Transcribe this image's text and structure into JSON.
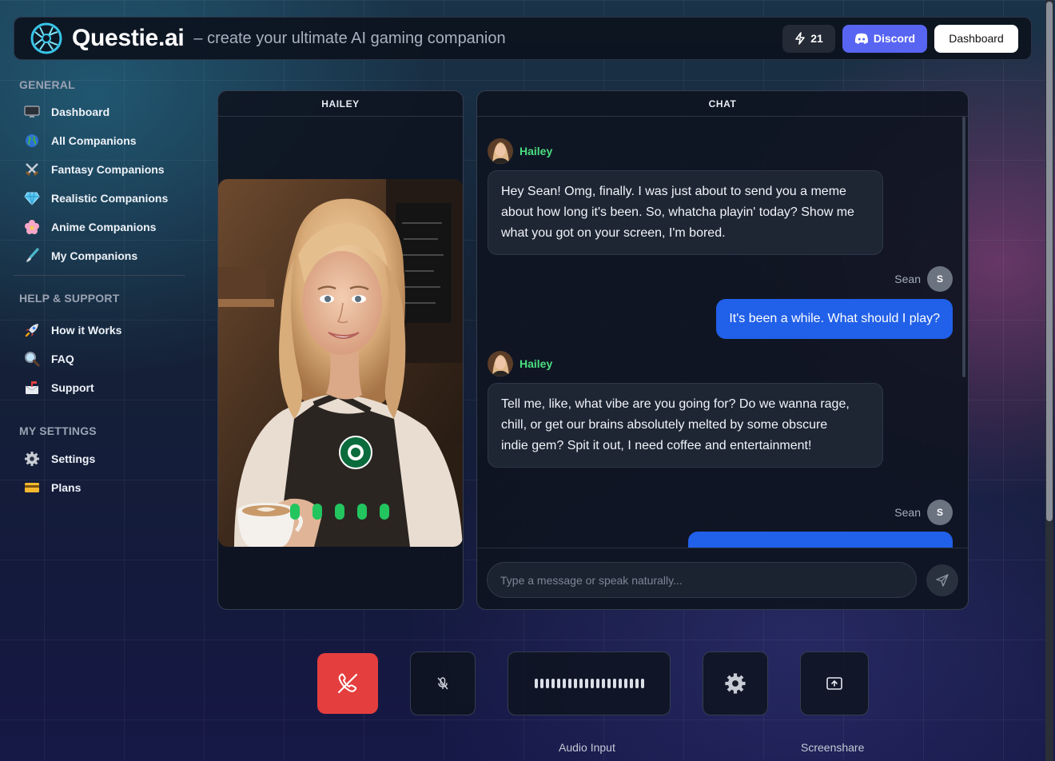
{
  "header": {
    "brand": "Questie.ai",
    "tagline": "– create your ultimate AI gaming companion",
    "credits": "21",
    "discord_label": "Discord",
    "dashboard_label": "Dashboard"
  },
  "sidebar": {
    "sections": [
      {
        "title": "GENERAL",
        "items": [
          {
            "label": "Dashboard",
            "icon": "monitor-icon"
          },
          {
            "label": "All Companions",
            "icon": "globe-icon"
          },
          {
            "label": "Fantasy Companions",
            "icon": "crossed-swords-icon"
          },
          {
            "label": "Realistic Companions",
            "icon": "gem-icon"
          },
          {
            "label": "Anime Companions",
            "icon": "cherry-blossom-icon"
          },
          {
            "label": "My Companions",
            "icon": "paintbrush-icon"
          }
        ]
      },
      {
        "title": "HELP & SUPPORT",
        "items": [
          {
            "label": "How it Works",
            "icon": "rocket-icon"
          },
          {
            "label": "FAQ",
            "icon": "magnifier-icon"
          },
          {
            "label": "Support",
            "icon": "mailbox-icon"
          }
        ]
      },
      {
        "title": "MY SETTINGS",
        "items": [
          {
            "label": "Settings",
            "icon": "gear-icon"
          },
          {
            "label": "Plans",
            "icon": "credit-card-icon"
          }
        ]
      }
    ]
  },
  "companion_panel": {
    "title": "HAILEY"
  },
  "chat": {
    "title": "CHAT",
    "messages": [
      {
        "sender": "Hailey",
        "role": "ai",
        "text": "Hey Sean! Omg, finally. I was just about to send you a meme about how long it's been. So, whatcha playin' today? Show me what you got on your screen, I'm bored."
      },
      {
        "sender": "Sean",
        "role": "user",
        "avatar_initial": "S",
        "text": "It's been a while. What should I play?"
      },
      {
        "sender": "Hailey",
        "role": "ai",
        "text": "Tell me, like, what vibe are you going for? Do we wanna rage, chill, or get our brains absolutely melted by some obscure indie gem? Spit it out, I need coffee and entertainment!"
      },
      {
        "sender": "Sean",
        "role": "user",
        "avatar_initial": "S",
        "text": ""
      }
    ],
    "input_placeholder": "Type a message or speak naturally..."
  },
  "controls": {
    "audio_input_label": "Audio Input",
    "screenshare_label": "Screenshare"
  },
  "colors": {
    "accent_blue": "#2160e8",
    "discord": "#5865f2",
    "end_call": "#e53e3e",
    "ai_name": "#4ade80",
    "speaking_indicator": "#22c55e"
  }
}
